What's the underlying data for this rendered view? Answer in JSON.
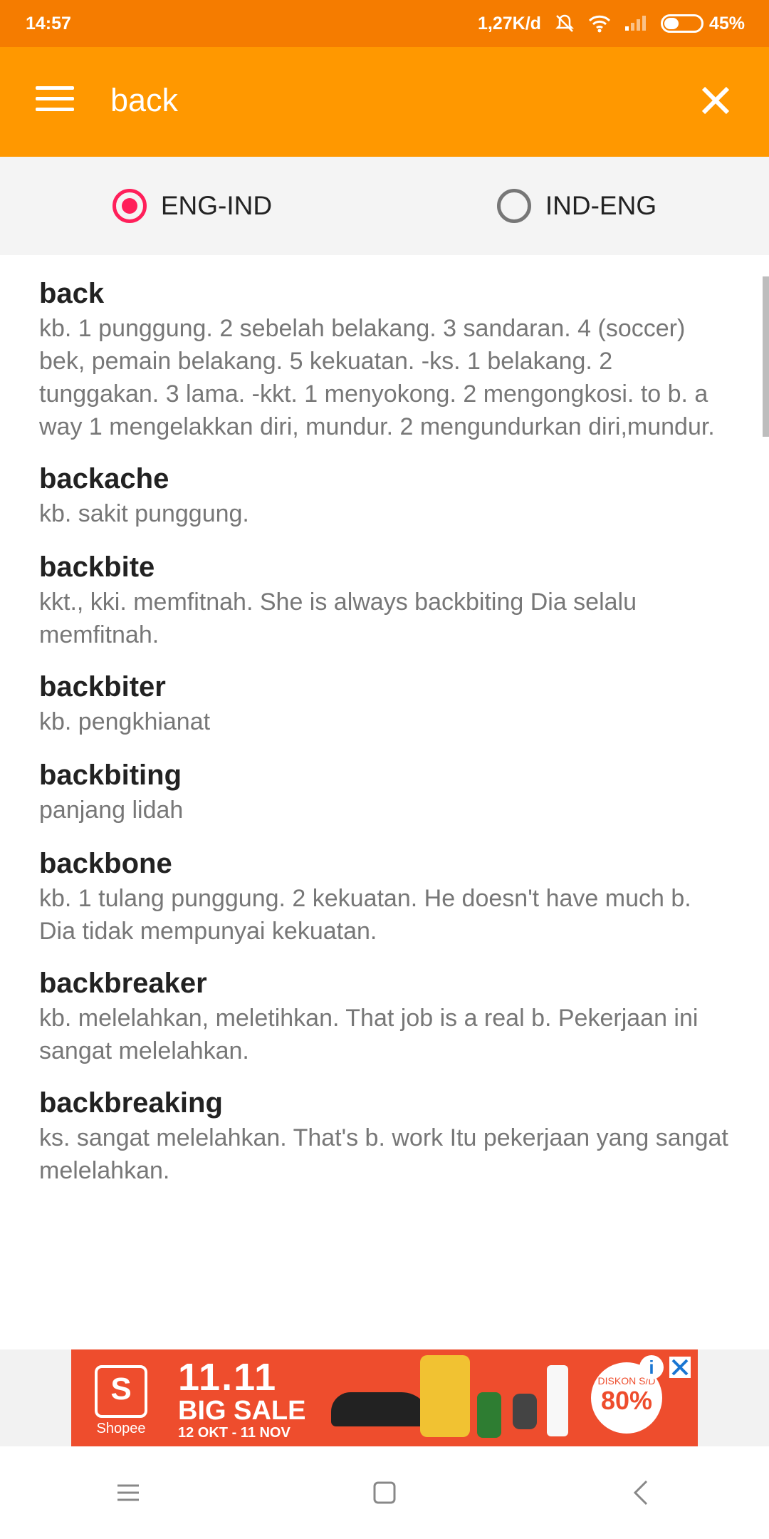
{
  "status_bar": {
    "time": "14:57",
    "network_speed": "1,27K/d",
    "battery": "45%",
    "battery_level": 0.45,
    "icons": [
      "bell-off-icon",
      "wifi-icon",
      "signal-icon",
      "battery-icon"
    ]
  },
  "app_bar": {
    "search_value": "back",
    "menu_icon": "hamburger-menu-icon",
    "close_icon": "close-icon"
  },
  "toggle": {
    "options": [
      {
        "label": "ENG-IND",
        "selected": true
      },
      {
        "label": "IND-ENG",
        "selected": false
      }
    ]
  },
  "entries": [
    {
      "word": "back",
      "definition": "kb. 1 punggung. 2 sebelah belakang. 3 sandaran. 4 (soccer) bek, pemain belakang. 5 kekuatan. -ks. 1 belakang. 2 tunggakan. 3 lama. -kkt. 1 menyokong. 2 mengongkosi. to b. a way 1 mengelakkan diri, mundur. 2 mengundurkan diri,mundur."
    },
    {
      "word": "backache",
      "definition": "kb. sakit punggung."
    },
    {
      "word": "backbite",
      "definition": "kkt., kki. memfitnah. She is always backbiting Dia selalu memfitnah."
    },
    {
      "word": "backbiter",
      "definition": "kb. pengkhianat"
    },
    {
      "word": "backbiting",
      "definition": "panjang lidah"
    },
    {
      "word": "backbone",
      "definition": "kb. 1 tulang punggung.  2 kekuatan. He doesn't have much b. Dia tidak mempunyai kekuatan."
    },
    {
      "word": "backbreaker",
      "definition": "kb. melelahkan, meletihkan. That job is a real b. Pekerjaan ini sangat melelahkan."
    },
    {
      "word": "backbreaking",
      "definition": "ks. sangat melelahkan. That's b. work Itu pekerjaan yang sangat melelahkan."
    }
  ],
  "ad": {
    "brand": "Shopee",
    "brand_letter": "S",
    "headline": "11.11",
    "sale_text": "BIG SALE",
    "dates": "12 OKT - 11 NOV",
    "discount_label": "DISKON S/D",
    "discount_value": "80%",
    "info_glyph": "i",
    "close_glyph": "✕"
  },
  "nav": {
    "buttons": [
      "recents-icon",
      "home-icon",
      "back-icon"
    ]
  },
  "colors": {
    "status_bar": "#f57c00",
    "app_bar": "#ff9800",
    "radio_selected": "#ff1f5a",
    "ad_background": "#ee4d2d"
  }
}
